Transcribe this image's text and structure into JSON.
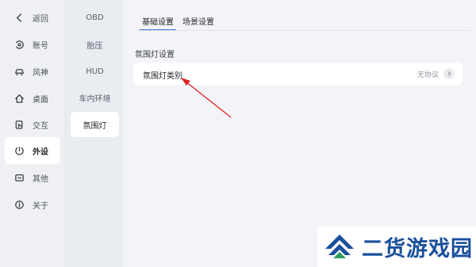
{
  "nav": {
    "items": [
      {
        "label": "返回",
        "icon": "chevron-left-icon"
      },
      {
        "label": "账号",
        "icon": "account-icon"
      },
      {
        "label": "风神",
        "icon": "car-icon"
      },
      {
        "label": "桌面",
        "icon": "home-icon"
      },
      {
        "label": "交互",
        "icon": "interaction-icon"
      },
      {
        "label": "外设",
        "icon": "peripheral-icon"
      },
      {
        "label": "其他",
        "icon": "other-icon"
      },
      {
        "label": "关于",
        "icon": "info-icon"
      }
    ],
    "active_index": 5
  },
  "subnav": {
    "items": [
      {
        "label": "OBD"
      },
      {
        "label": "胎压"
      },
      {
        "label": "HUD"
      },
      {
        "label": "车内环境"
      },
      {
        "label": "氛围灯"
      }
    ],
    "active_index": 4
  },
  "tabs": [
    {
      "label": "基础设置",
      "active": true
    },
    {
      "label": "场景设置",
      "active": false
    }
  ],
  "section": {
    "title": "氛围灯设置",
    "row": {
      "label": "氛围灯类别",
      "value": "无协议",
      "icon": "chevron-right-icon"
    }
  },
  "watermark": {
    "text": "二货游戏园",
    "logo": "watermark-logo"
  },
  "colors": {
    "accent": "#3a6fd8",
    "annotation_arrow": "#e02020",
    "watermark": "#1a4f9c"
  }
}
